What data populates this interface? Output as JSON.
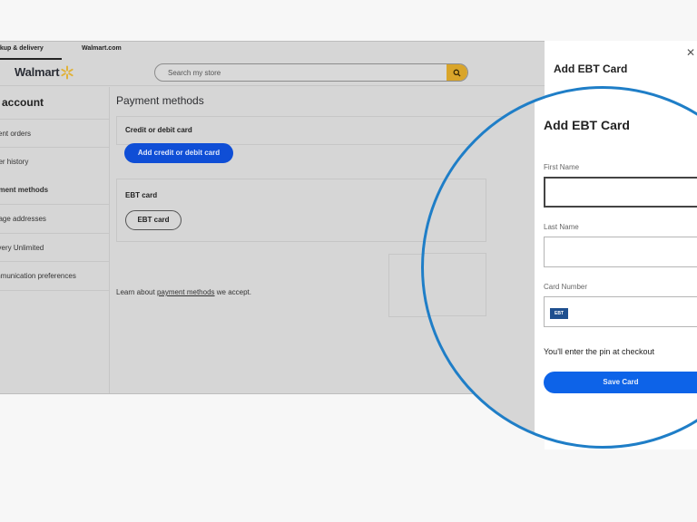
{
  "topnav": {
    "tabs": [
      {
        "label": "ckup & delivery",
        "active": true
      },
      {
        "label": "Walmart.com",
        "active": false
      }
    ]
  },
  "header": {
    "logo": "Walmart",
    "logo_icon": "spark-icon",
    "search_placeholder": "Search my store",
    "search_icon": "search-icon",
    "accent_color": "#d9a52a"
  },
  "sidebar": {
    "title": "y account",
    "items": [
      {
        "label": "cent orders",
        "active": false
      },
      {
        "label": "der history",
        "active": false
      },
      {
        "label": "yment methods",
        "active": true
      },
      {
        "label": "nage addresses",
        "active": false
      },
      {
        "label": "livery Unlimited",
        "active": false
      },
      {
        "label": "mmunication preferences",
        "active": false
      }
    ]
  },
  "main": {
    "title": "Payment methods",
    "credit_card": {
      "title": "Credit or debit card",
      "button": "Add credit or debit card"
    },
    "ebt": {
      "title": "EBT card",
      "button": "EBT card"
    },
    "learn": {
      "prefix": "Learn about ",
      "link": "payment methods",
      "suffix": " we accept."
    }
  },
  "drawer": {
    "title": "Add EBT Card",
    "close_icon": "close-icon"
  },
  "magnified": {
    "title": "Add EBT Card",
    "fields": [
      {
        "label": "First Name",
        "value": "",
        "focused": true
      },
      {
        "label": "Last Name",
        "value": "",
        "focused": false
      },
      {
        "label": "Card Number",
        "value": "",
        "badge": "EBT"
      }
    ],
    "hint": "You'll enter the pin at checkout",
    "save_button": "Save Card",
    "ring_color": "#1f7ec7",
    "button_color": "#0d63e8"
  }
}
